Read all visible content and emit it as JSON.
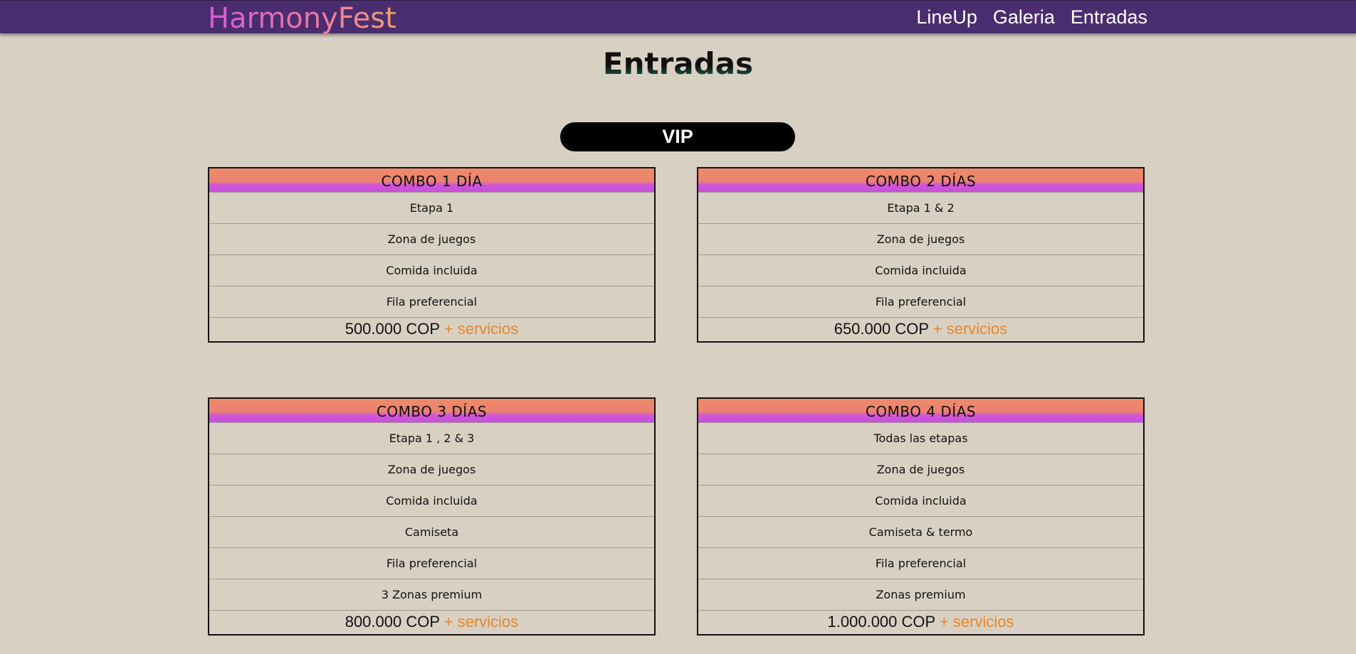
{
  "nav": {
    "brand": "HarmonyFest",
    "links": [
      "LineUp",
      "Galeria",
      "Entradas"
    ]
  },
  "page": {
    "title": "Entradas",
    "category": "VIP"
  },
  "colors": {
    "nav_background": "#4a2d6e",
    "page_background": "#d8d1c3",
    "price_extra": "#e8862b",
    "header_gradient_top": "#ef8a6a",
    "header_gradient_bottom": "#c84fdc"
  },
  "cards": [
    {
      "title": "COMBO 1 DÍA",
      "features": [
        "Etapa 1",
        "Zona de juegos",
        "Comida incluida",
        "Fila preferencial"
      ],
      "price": "500.000 COP",
      "price_extra": "+ servicios"
    },
    {
      "title": "COMBO 2 DÍAS",
      "features": [
        "Etapa 1 & 2",
        "Zona de juegos",
        "Comida incluida",
        "Fila preferencial"
      ],
      "price": "650.000 COP",
      "price_extra": "+ servicios"
    },
    {
      "title": "COMBO 3 DÍAS",
      "features": [
        "Etapa 1 , 2 & 3",
        "Zona de juegos",
        "Comida incluida",
        "Camiseta",
        "Fila preferencial",
        "3 Zonas premium"
      ],
      "price": "800.000 COP",
      "price_extra": "+ servicios"
    },
    {
      "title": "COMBO 4 DÍAS",
      "features": [
        "Todas las etapas",
        "Zona de juegos",
        "Comida incluida",
        "Camiseta & termo",
        "Fila preferencial",
        "Zonas premium"
      ],
      "price": "1.000.000 COP",
      "price_extra": "+ servicios"
    }
  ]
}
